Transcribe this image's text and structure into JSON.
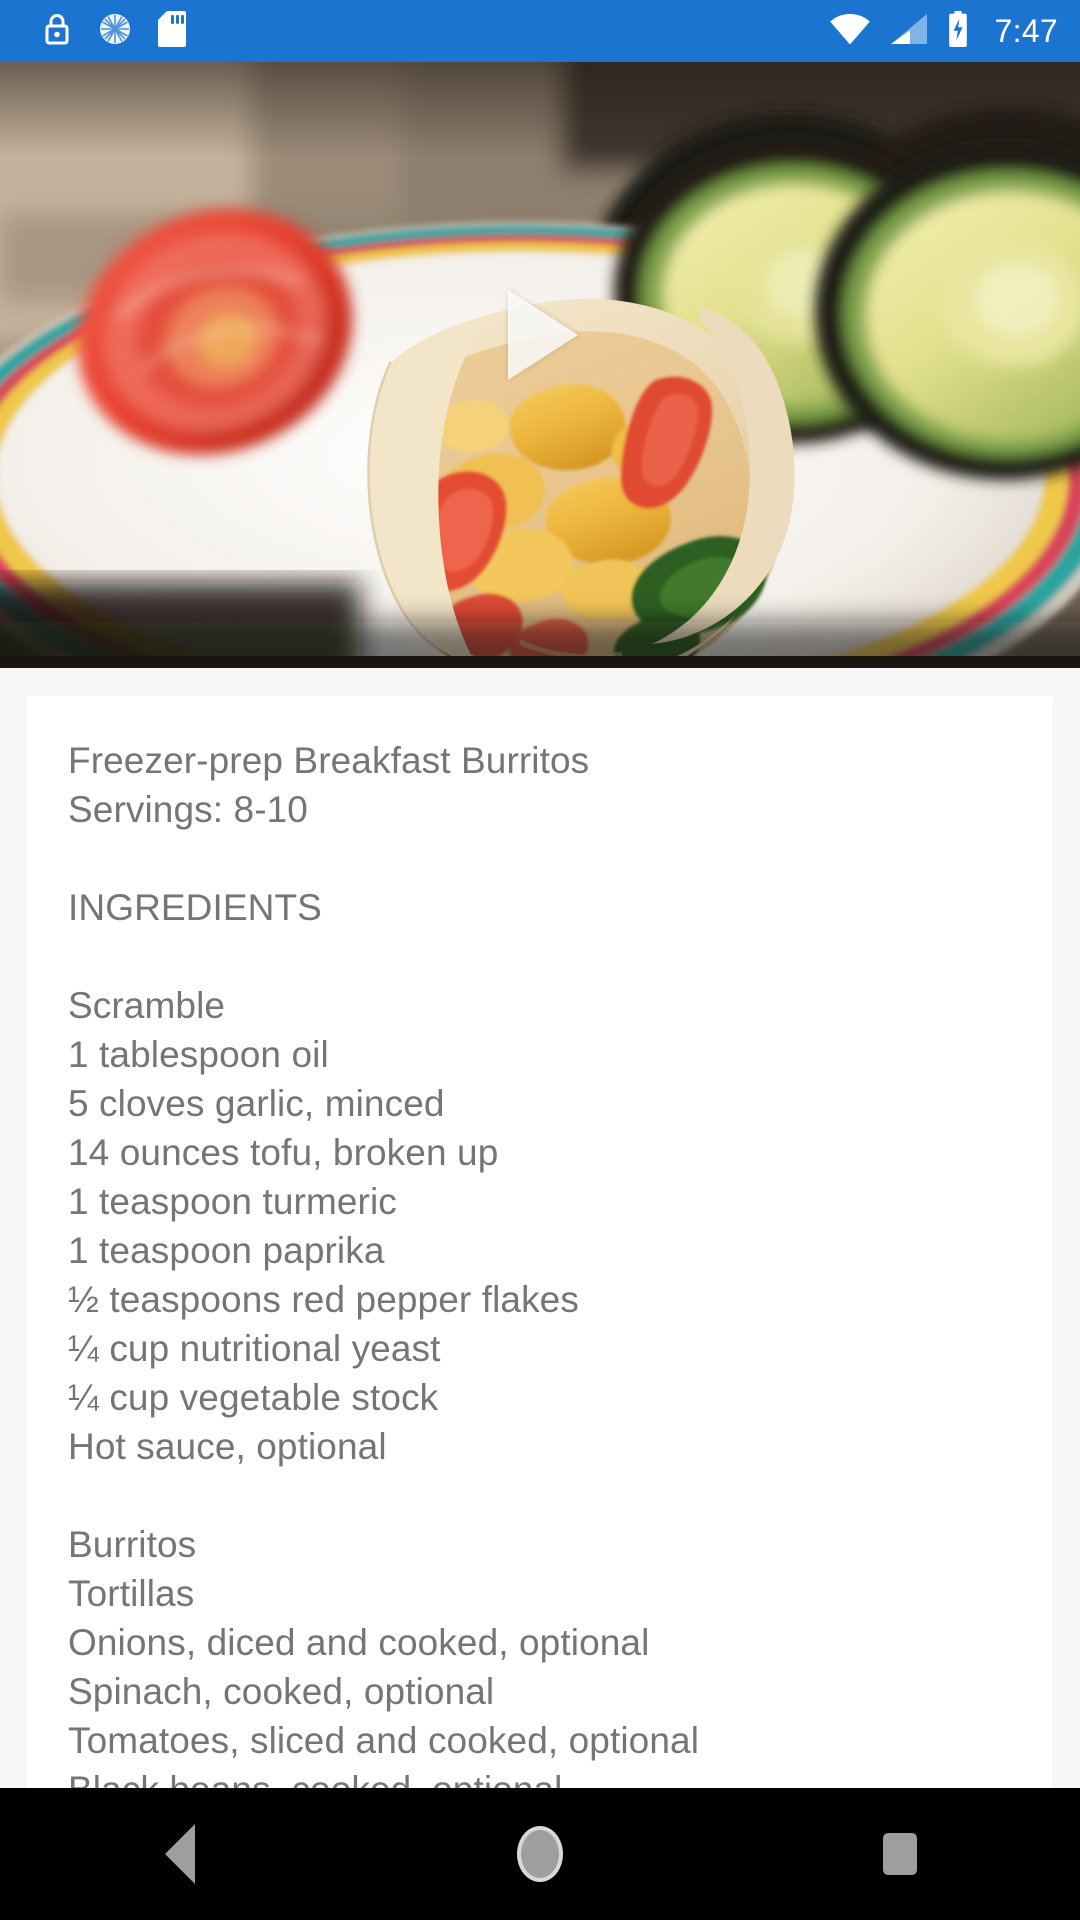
{
  "status_bar": {
    "background_color": "#1b75d0",
    "clock": "7:47",
    "left_icons": [
      {
        "name": "lock-icon",
        "label": "Screen lock"
      },
      {
        "name": "sync-spinner-icon",
        "label": "Syncing"
      },
      {
        "name": "sd-card-icon",
        "label": "SD card"
      }
    ],
    "right_icons": [
      {
        "name": "wifi-icon",
        "label": "Wi-Fi connected"
      },
      {
        "name": "cellular-signal-icon",
        "label": "Cellular signal"
      },
      {
        "name": "battery-charging-icon",
        "label": "Battery charging"
      }
    ]
  },
  "video": {
    "play_label": "Play video",
    "overlay_icon": "play-triangle-icon",
    "scene_description": "Sliced breakfast burrito on a plate with tomato slices and avocado halves"
  },
  "recipe": {
    "title": "Freezer-prep Breakfast Burritos",
    "servings_line": "Servings: 8-10",
    "ingredients_heading": "INGREDIENTS",
    "sections": [
      {
        "name": "Scramble",
        "items": [
          "1 tablespoon oil",
          "5 cloves garlic, minced",
          "14 ounces tofu, broken up",
          "1 teaspoon turmeric",
          "1 teaspoon paprika",
          "½ teaspoons red pepper flakes",
          "¼ cup nutritional yeast",
          "¼ cup vegetable stock",
          "Hot sauce, optional"
        ]
      },
      {
        "name": "Burritos",
        "items": [
          "Tortillas",
          "Onions, diced and cooked, optional",
          "Spinach, cooked, optional",
          "Tomatoes, sliced and cooked, optional"
        ]
      }
    ],
    "body_text": "Freezer-prep Breakfast Burritos\nServings: 8-10\n\nINGREDIENTS\n\nScramble\n1 tablespoon oil\n5 cloves garlic, minced\n14 ounces tofu, broken up\n1 teaspoon turmeric\n1 teaspoon paprika\n½ teaspoons red pepper flakes\n¼ cup nutritional yeast\n¼ cup vegetable stock\nHot sauce, optional\n\nBurritos\nTortillas\nOnions, diced and cooked, optional\nSpinach, cooked, optional\nTomatoes, sliced and cooked, optional\nBlack beans, cooked, optional",
    "text_color": "#757575",
    "card_color": "#ffffff",
    "page_background": "#f7f7f7"
  },
  "navigation_bar": {
    "background_color": "#000000",
    "buttons": [
      {
        "name": "back-button",
        "label": "Back"
      },
      {
        "name": "home-button",
        "label": "Home"
      },
      {
        "name": "recents-button",
        "label": "Recent apps"
      }
    ]
  }
}
